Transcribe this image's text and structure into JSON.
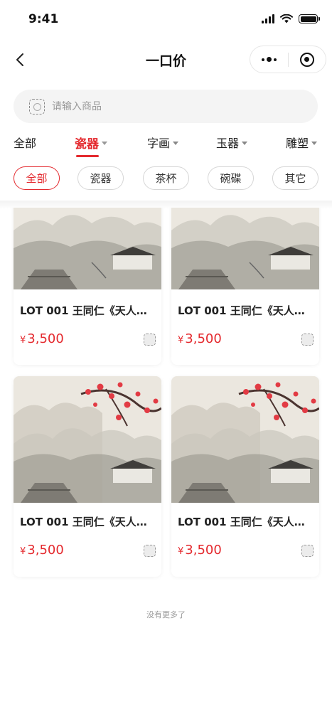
{
  "status_bar": {
    "time": "9:41"
  },
  "nav": {
    "title": "一口价"
  },
  "search": {
    "placeholder": "请输入商品"
  },
  "category_tabs": [
    {
      "label": "全部",
      "active": false,
      "dropdown": false
    },
    {
      "label": "瓷器",
      "active": true,
      "dropdown": true
    },
    {
      "label": "字画",
      "active": false,
      "dropdown": true
    },
    {
      "label": "玉器",
      "active": false,
      "dropdown": true
    },
    {
      "label": "雕塑",
      "active": false,
      "dropdown": true
    }
  ],
  "sub_chips": [
    {
      "label": "全部",
      "active": true
    },
    {
      "label": "瓷器",
      "active": false
    },
    {
      "label": "茶杯",
      "active": false
    },
    {
      "label": "碗碟",
      "active": false
    },
    {
      "label": "其它",
      "active": false
    }
  ],
  "products": [
    {
      "title": "LOT 001 王同仁《天人…",
      "currency": "¥",
      "price": "3,500"
    },
    {
      "title": "LOT 001 王同仁《天人…",
      "currency": "¥",
      "price": "3,500"
    },
    {
      "title": "LOT 001 王同仁《天人…",
      "currency": "¥",
      "price": "3,500"
    },
    {
      "title": "LOT 001 王同仁《天人…",
      "currency": "¥",
      "price": "3,500"
    }
  ],
  "footer": {
    "no_more": "没有更多了"
  },
  "colors": {
    "accent": "#e4292e",
    "search_bg": "#f4f4f4",
    "text": "#222222"
  }
}
